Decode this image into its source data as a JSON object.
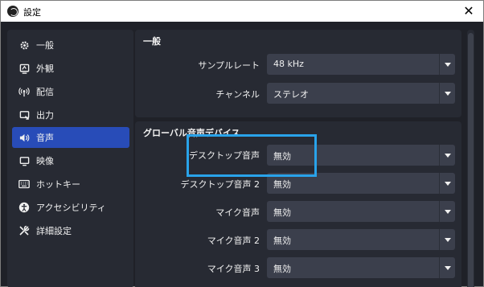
{
  "window": {
    "title": "設定",
    "close_glyph": "✕",
    "app_icon": "obs-logo-icon"
  },
  "sidebar": {
    "items": [
      {
        "label": "一般",
        "icon": "gear-icon",
        "glyph": "⚙",
        "active": false
      },
      {
        "label": "外観",
        "icon": "appearance-icon",
        "glyph": "▣",
        "active": false
      },
      {
        "label": "配信",
        "icon": "broadcast-icon",
        "glyph": "((•))",
        "active": false
      },
      {
        "label": "出力",
        "icon": "output-icon",
        "glyph": "▭",
        "active": false
      },
      {
        "label": "音声",
        "icon": "speaker-icon",
        "glyph": "◂)",
        "active": true
      },
      {
        "label": "映像",
        "icon": "monitor-icon",
        "glyph": "▭",
        "active": false
      },
      {
        "label": "ホットキー",
        "icon": "keyboard-icon",
        "glyph": "▦",
        "active": false
      },
      {
        "label": "アクセシビリティ",
        "icon": "accessibility-icon",
        "glyph": "◉",
        "active": false
      },
      {
        "label": "詳細設定",
        "icon": "tools-icon",
        "glyph": "✕",
        "active": false
      }
    ]
  },
  "general": {
    "title": "一般",
    "rows": [
      {
        "label": "サンプルレート",
        "value": "48 kHz"
      },
      {
        "label": "チャンネル",
        "value": "ステレオ"
      }
    ]
  },
  "global_devices": {
    "title": "グローバル音声デバイス",
    "rows": [
      {
        "label": "デスクトップ音声",
        "value": "無効"
      },
      {
        "label": "デスクトップ音声 2",
        "value": "無効"
      },
      {
        "label": "マイク音声",
        "value": "無効"
      },
      {
        "label": "マイク音声 2",
        "value": "無効"
      },
      {
        "label": "マイク音声 3",
        "value": "無効"
      }
    ]
  },
  "colors": {
    "background": "#1f2128",
    "panel": "#272a33",
    "select": "#3b3f4c",
    "active_nav": "#284cb8",
    "highlight": "#29a3ea"
  }
}
